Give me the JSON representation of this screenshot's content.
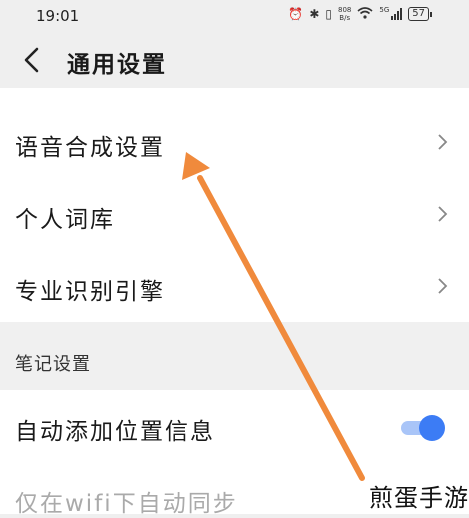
{
  "status_bar": {
    "time": "19:01",
    "speed_top": "808",
    "speed_bottom": "B/s",
    "network": "5G",
    "battery": "57"
  },
  "header": {
    "title": "通用设置"
  },
  "items": [
    {
      "label": "语音合成设置"
    },
    {
      "label": "个人词库"
    },
    {
      "label": "专业识别引擎"
    }
  ],
  "notes_section": {
    "title": "笔记设置",
    "auto_location": {
      "label": "自动添加位置信息",
      "enabled": true
    },
    "wifi_sync": {
      "label": "仅在wifi下自动同步"
    }
  },
  "watermark": "煎蛋手游",
  "colors": {
    "toggle_on": "#3c7cf5",
    "arrow": "#f08a3c"
  }
}
